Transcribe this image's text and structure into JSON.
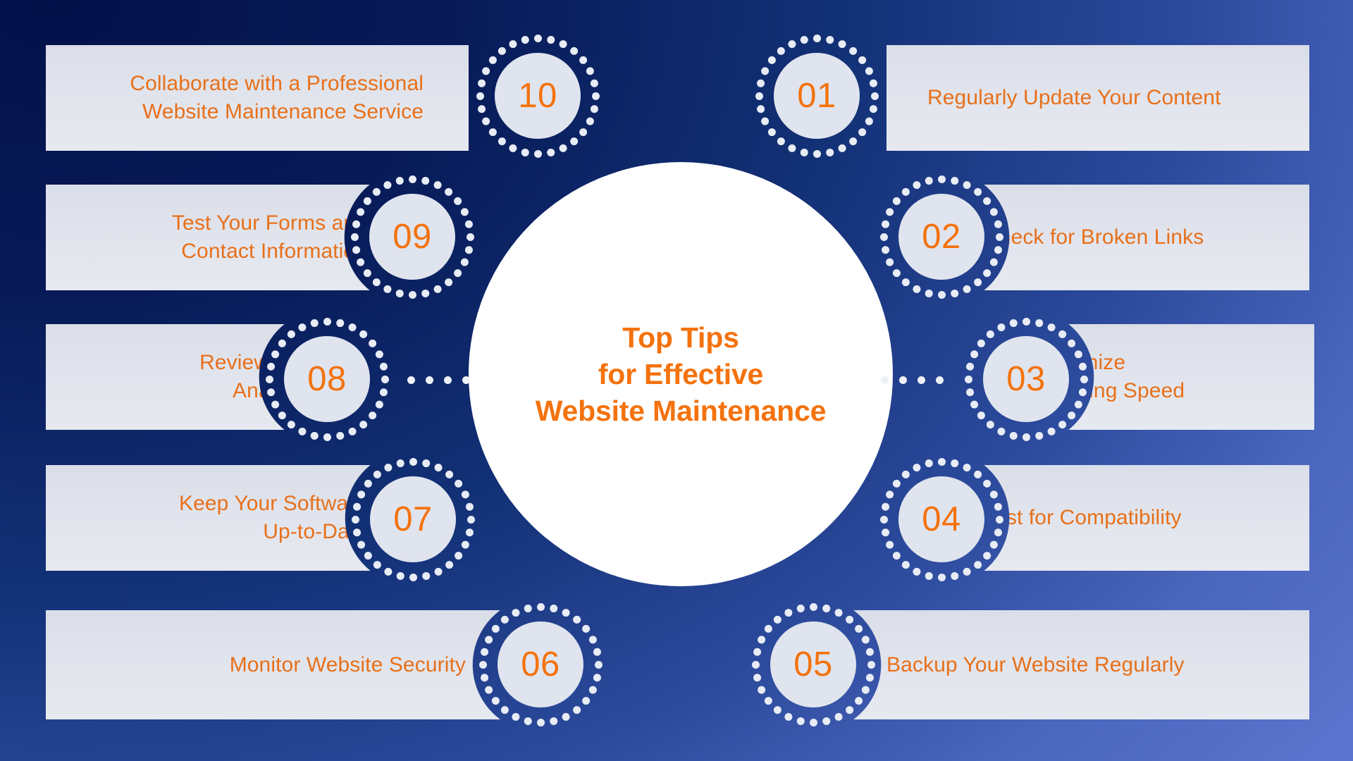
{
  "center": {
    "title": "Top Tips\nfor Effective\nWebsite Maintenance"
  },
  "theme": {
    "accent_orange": "#f4720d",
    "text_orange": "#e8701a",
    "bar_gray": "#e2e5ed",
    "bg_dark_navy": "#04114a",
    "bg_light_blue": "#5a73cc",
    "dot_white": "#e8ecf5"
  },
  "items": [
    {
      "number": "01",
      "label": "Regularly Update Your Content",
      "side": "right"
    },
    {
      "number": "02",
      "label": "Check for Broken Links",
      "side": "right"
    },
    {
      "number": "03",
      "label": "Optimize\nLoading Speed",
      "side": "right"
    },
    {
      "number": "04",
      "label": "Test for Compatibility",
      "side": "right"
    },
    {
      "number": "05",
      "label": "Backup Your Website Regularly",
      "side": "right"
    },
    {
      "number": "06",
      "label": "Monitor Website Security",
      "side": "left"
    },
    {
      "number": "07",
      "label": "Keep Your Software\nUp-to-Date",
      "side": "left"
    },
    {
      "number": "08",
      "label": "Review Your\nAnalytics",
      "side": "left"
    },
    {
      "number": "09",
      "label": "Test Your Forms and\nContact Information",
      "side": "left"
    },
    {
      "number": "10",
      "label": "Collaborate with a Professional\nWebsite Maintenance Service",
      "side": "left"
    }
  ]
}
